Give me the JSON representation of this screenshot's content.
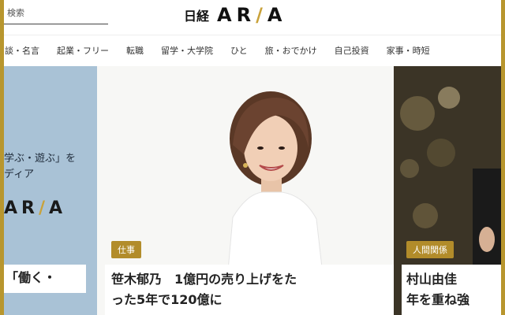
{
  "header": {
    "search_label": "検索",
    "logo_nikkei": "日経",
    "logo_aria_a": "AR",
    "logo_aria_slash": "/",
    "logo_aria_b": "A"
  },
  "nav": {
    "items": [
      "談・名言",
      "起業・フリー",
      "転職",
      "留学・大学院",
      "ひと",
      "旅・おでかけ",
      "自己投資",
      "家事・時短"
    ]
  },
  "cards": {
    "left": {
      "copy_line1": "学ぶ・遊ぶ」を",
      "copy_line2": "ディア",
      "logo_a": "AR",
      "logo_slash": "/",
      "logo_b": "A",
      "title": "「働く・"
    },
    "center": {
      "badge": "仕事",
      "title_line1": "笹木郁乃　1億円の売り上げをた",
      "title_line2": "った5年で120億に"
    },
    "right": {
      "badge": "人間関係",
      "title_line1": "村山由佳　",
      "title_line2": "年を重ね強"
    }
  },
  "colors": {
    "accent_gold": "#b8962e",
    "badge_gold": "#b28c2a"
  }
}
